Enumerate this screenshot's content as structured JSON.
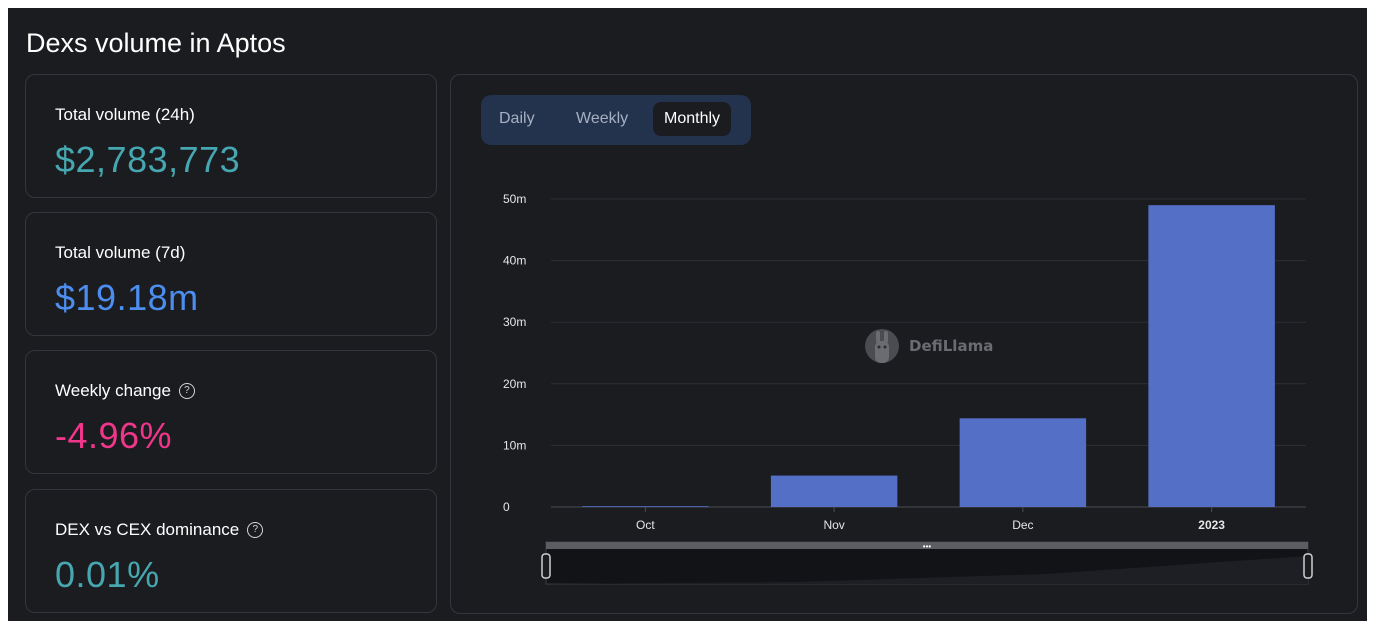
{
  "page": {
    "title": "Dexs volume in Aptos"
  },
  "stats": [
    {
      "label": "Total volume (24h)",
      "value": "$2,783,773",
      "color": "#46a7b0",
      "help": false
    },
    {
      "label": "Total volume (7d)",
      "value": "$19.18m",
      "color": "#4c8ef0",
      "help": false
    },
    {
      "label": "Weekly change",
      "value": "-4.96%",
      "color": "#f0368b",
      "help": true
    },
    {
      "label": "DEX vs CEX dominance",
      "value": "0.01%",
      "color": "#46a7b0",
      "help": true
    }
  ],
  "tabs": [
    {
      "label": "Daily",
      "active": false
    },
    {
      "label": "Weekly",
      "active": false
    },
    {
      "label": "Monthly",
      "active": true
    }
  ],
  "watermark": {
    "text": "DefiLlama",
    "icon": "llama-logo-icon"
  },
  "colors": {
    "bar": "#5470c6",
    "grid": "#2c2e35",
    "brush": "#5b5d63"
  },
  "chart_data": {
    "type": "bar",
    "categories": [
      "Oct",
      "Nov",
      "Dec",
      "2023"
    ],
    "values": [
      0.1,
      5.1,
      14.4,
      49.0
    ],
    "unit": "m",
    "ylim": [
      0,
      50
    ],
    "yticks": [
      "0",
      "10m",
      "20m",
      "30m",
      "40m",
      "50m"
    ],
    "grid": true,
    "legend": "none",
    "bold_category": "2023"
  }
}
